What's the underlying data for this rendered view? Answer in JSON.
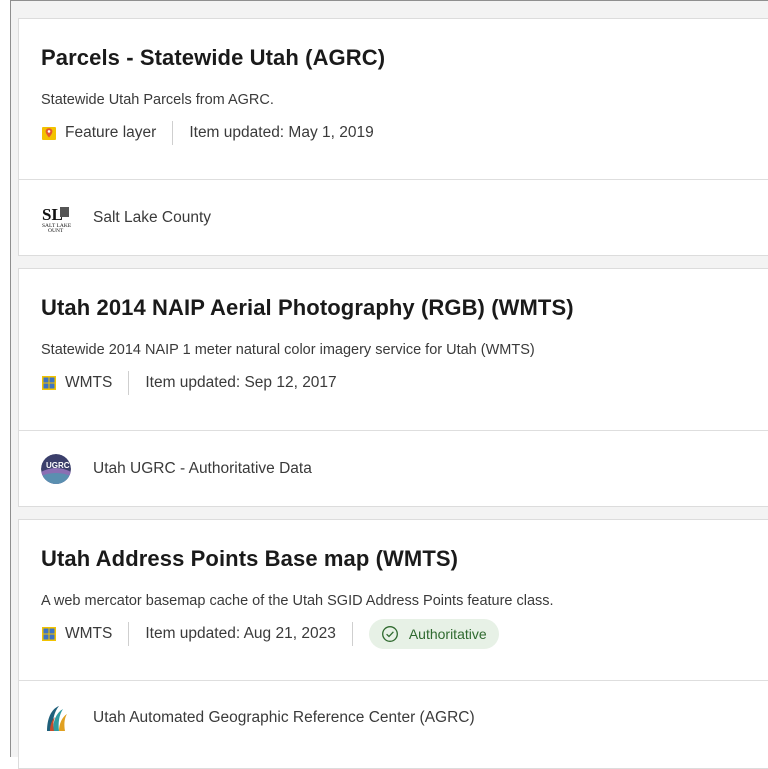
{
  "results": [
    {
      "title": "Parcels - Statewide Utah (AGRC)",
      "description": "Statewide Utah Parcels from AGRC.",
      "type_icon": "feature-layer-icon",
      "type_label": "Feature layer",
      "updated": "Item updated: May 1, 2019",
      "badge": "",
      "owner": "Salt Lake County",
      "owner_avatar": "salt-lake-county-logo"
    },
    {
      "title": "Utah 2014 NAIP Aerial Photography (RGB) (WMTS)",
      "description": "Statewide 2014 NAIP 1 meter natural color imagery service for Utah (WMTS)",
      "type_icon": "wmts-icon",
      "type_label": "WMTS",
      "updated": "Item updated: Sep 12, 2017",
      "badge": "",
      "owner": "Utah UGRC - Authoritative Data",
      "owner_avatar": "ugrc-logo"
    },
    {
      "title": "Utah Address Points Base map (WMTS)",
      "description": "A web mercator basemap cache of the Utah SGID Address Points feature class.",
      "type_icon": "wmts-icon",
      "type_label": "WMTS",
      "updated": "Item updated: Aug 21, 2023",
      "badge": "Authoritative",
      "badge_icon": "check-circle-icon",
      "owner": "Utah Automated Geographic Reference Center (AGRC)",
      "owner_avatar": "agrc-logo"
    }
  ],
  "colors": {
    "badge_bg": "#e7f1e6",
    "badge_text": "#2f6a2f",
    "feature_icon": "#f0b400",
    "wmts_icon": "#e8b000"
  }
}
